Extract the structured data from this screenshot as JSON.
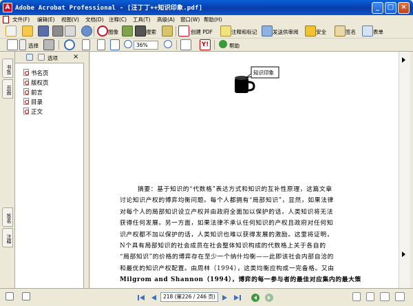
{
  "window": {
    "title": "Adobe Acrobat Professional - [汪丁丁++知识印象.pdf]"
  },
  "menu": {
    "items": [
      "文件(F)",
      "编辑(E)",
      "视图(V)",
      "文档(D)",
      "注释(C)",
      "工具(T)",
      "高级(A)",
      "窗口(W)",
      "帮助(H)"
    ]
  },
  "toolbar": {
    "search_label": "搜索",
    "create_pdf_label": "创建 PDF",
    "review_label": "注释和标记",
    "send_label": "发送供审阅",
    "secure_label": "安全",
    "sign_label": "签名",
    "form_label": "表单",
    "select_label": "选择",
    "zoom_value": "36%",
    "help_label": "帮助"
  },
  "bookmarks": {
    "options_label": "选项",
    "items": [
      "书名页",
      "版权页",
      "前言",
      "目录",
      "正文"
    ]
  },
  "left_tabs": {
    "bookmarks": "书签",
    "pages": "页面",
    "signatures": "签名",
    "comments": "注释"
  },
  "document": {
    "logo_caption": "知识印象",
    "lines": [
      "摘要：基于知识的“代数格”表达方式和知识的互补性原理，这篇文章",
      "讨论知识产权的博弈均衡问题。每个人都拥有“局部知识”，显然，如果法律",
      "对每个人的局部知识设立产权并由政府全面加以保护的话，人类知识将无法",
      "获得任何发展。另一方面，如果法律不承认任何知识的产权且政府对任何知",
      "识产权都不加以保护的话，人类知识也难以获得发展的激励。这里将证明，",
      "N个具有局部知识的社会成员在社会整体知识构成的代数格上关于各自的",
      "“局部知识”的价格的博弈存在至少一个纳什均衡——此即该社会内部自洽的",
      "和最优的知识产权配置。由周林（1994），这类均衡应构成一完备格。又由",
      "Milgrom and Shannon（1994），博弈的每一参与者的最佳对应集内的最大策"
    ]
  },
  "statusbar": {
    "page_display": "218 (第226 / 246 页)"
  }
}
